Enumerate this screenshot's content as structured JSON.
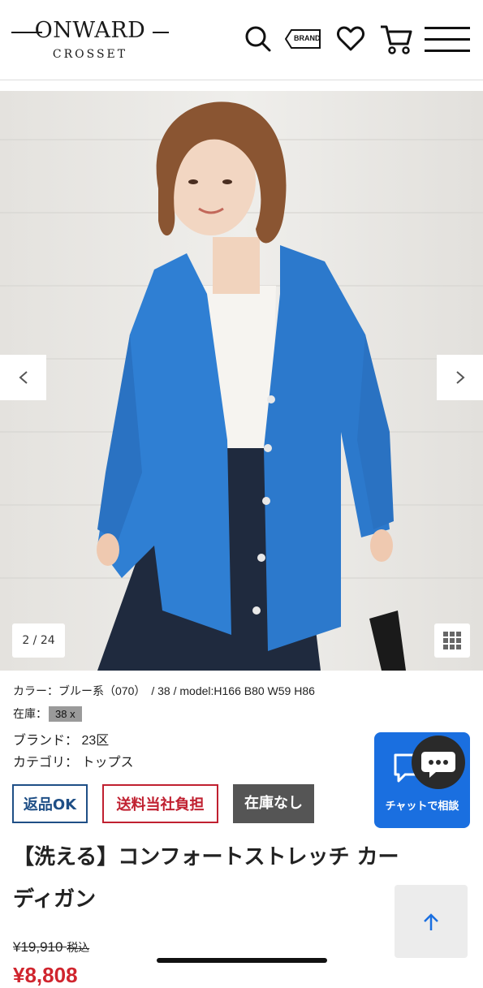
{
  "header": {
    "logo_main": "ONWARD",
    "logo_sub": "CROSSET",
    "brand_button": "BRAND"
  },
  "gallery": {
    "counter": "2 / 24"
  },
  "product": {
    "spec_line": "カラー：ブルー系（070）　/  38  /  model:H166 B80 W59 H86",
    "stock_label": "在庫：",
    "stock_chip": "38 x",
    "brand_label": "ブランド：",
    "brand_value": "23区",
    "category_label": "カテゴリ：",
    "category_value": "トップス",
    "badges": [
      "返品OK",
      "送料当社負担",
      "在庫なし"
    ],
    "title_line1": "【洗える】コンフォートストレッチ カー",
    "title_line2": "ディガン",
    "price_old": "¥19,910",
    "price_old_tax": "税込",
    "price_new": "¥8,808"
  },
  "chat": {
    "label": "チャットで相談"
  },
  "colors": {
    "accent_blue": "#1a6fe0",
    "return_ok": "#1f4f86",
    "shipping": "#c02030",
    "out_of_stock_bg": "#555555",
    "sale_red": "#d0252e"
  },
  "icons": [
    "search-icon",
    "brand-tag-icon",
    "heart-icon",
    "cart-icon",
    "menu-icon",
    "chevron-left-icon",
    "chevron-right-icon",
    "grid-icon",
    "chat-icon",
    "arrow-up-icon"
  ]
}
